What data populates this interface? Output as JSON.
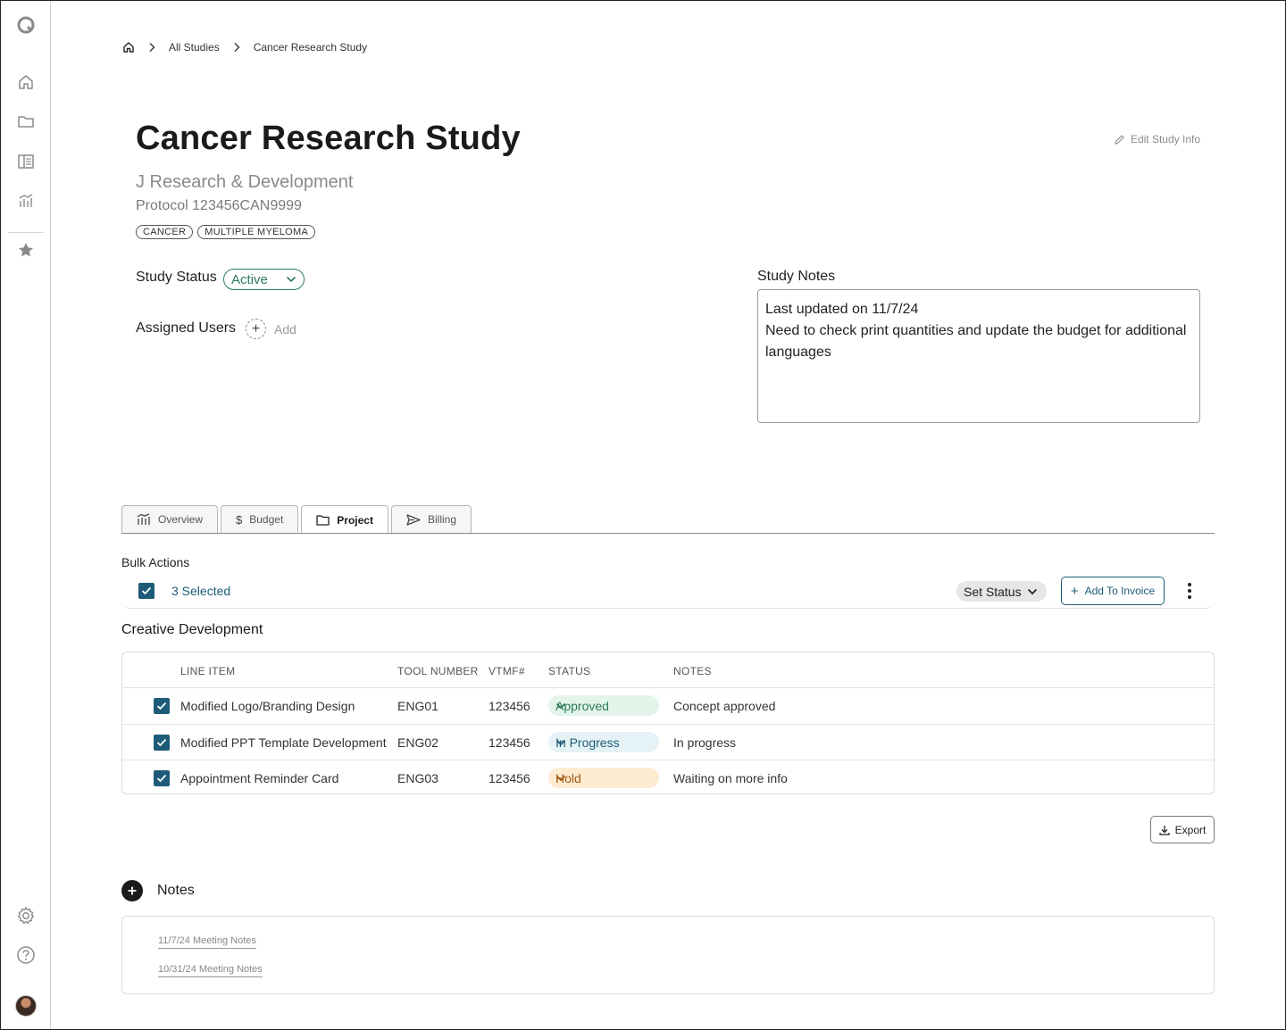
{
  "sidebar": {
    "icons": [
      "logo-icon",
      "home-icon",
      "folder-icon",
      "studies-list-icon",
      "analytics-icon",
      "star-icon",
      "settings-icon",
      "help-icon"
    ]
  },
  "breadcrumb": {
    "items": [
      "All Studies",
      "Cancer Research Study"
    ]
  },
  "header": {
    "title": "Cancer Research Study",
    "sponsor": "J Research & Development",
    "protocol": "Protocol 123456CAN9999",
    "tags": [
      "CANCER",
      "MULTIPLE MYELOMA"
    ],
    "edit_label": "Edit Study Info"
  },
  "study_status": {
    "label": "Study Status",
    "value": "Active",
    "color": "#2d7a5c"
  },
  "assigned_users": {
    "label": "Assigned Users",
    "add_label": "Add"
  },
  "study_notes": {
    "label": "Study Notes",
    "line1": "Last updated on 11/7/24",
    "line2": "Need to check print quantities and update the budget for additional languages"
  },
  "tabs": [
    {
      "label": "Overview",
      "icon": "analytics-icon"
    },
    {
      "label": "Budget",
      "icon": "dollar-icon"
    },
    {
      "label": "Project",
      "icon": "folder-icon",
      "active": true
    },
    {
      "label": "Billing",
      "icon": "send-icon"
    }
  ],
  "bulk_actions": {
    "label": "Bulk Actions",
    "selected_text": "3 Selected",
    "set_status_label": "Set Status",
    "add_invoice_label": "Add To Invoice"
  },
  "section": {
    "title": "Creative Development",
    "columns": [
      "LINE ITEM",
      "TOOL NUMBER",
      "VTMF#",
      "STATUS",
      "NOTES"
    ],
    "rows": [
      {
        "line_item": "Modified Logo/Branding Design",
        "tool_number": "ENG01",
        "vtmf": "123456",
        "status": "Approved",
        "status_bg": "#e3f4ea",
        "status_color": "#2d7a5c",
        "notes": "Concept approved"
      },
      {
        "line_item": "Modified PPT Template Development",
        "tool_number": "ENG02",
        "vtmf": "123456",
        "status": "In Progress",
        "status_bg": "#e5f2f6",
        "status_color": "#1d5b78",
        "notes": "In progress"
      },
      {
        "line_item": "Appointment Reminder Card",
        "tool_number": "ENG03",
        "vtmf": "123456",
        "status": "Hold",
        "status_bg": "#fdebd2",
        "status_color": "#a35a12",
        "notes": "Waiting on more info"
      }
    ]
  },
  "export_label": "Export",
  "notes_section": {
    "title": "Notes",
    "items": [
      "11/7/24 Meeting Notes",
      "10/31/24 Meeting Notes"
    ]
  }
}
